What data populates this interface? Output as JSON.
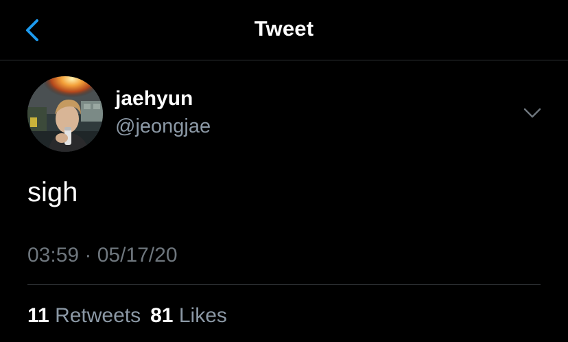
{
  "header": {
    "title": "Tweet",
    "back_icon": "chevron-left-icon"
  },
  "tweet": {
    "author": {
      "display_name": "jaehyun",
      "handle": "@jeongjae",
      "avatar": "profile-photo"
    },
    "more_icon": "chevron-down-icon",
    "text": "sigh",
    "timestamp": "03:59 · 05/17/20",
    "stats": {
      "retweets_count": "11",
      "retweets_label": "Retweets",
      "likes_count": "81",
      "likes_label": "Likes"
    }
  },
  "colors": {
    "background": "#000000",
    "accent": "#1d9bf0",
    "primary_text": "#ffffff",
    "secondary_text": "#8b98a5",
    "divider": "#2f3336"
  }
}
